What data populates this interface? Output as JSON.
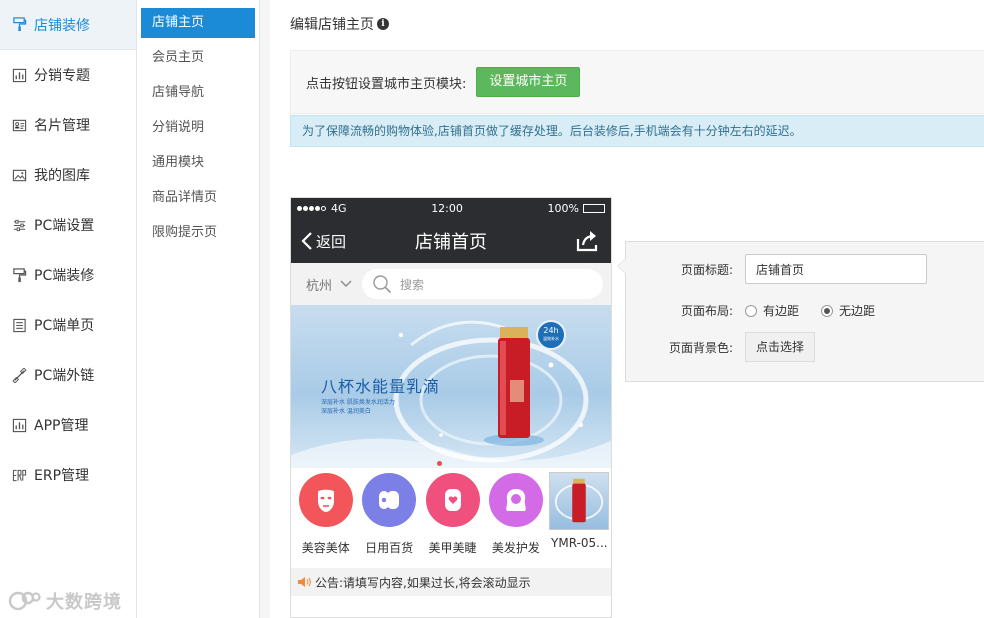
{
  "left_nav": {
    "items": [
      {
        "label": "店铺装修",
        "icon": "brush-icon",
        "active": true
      },
      {
        "label": "分销专题",
        "icon": "chart-icon"
      },
      {
        "label": "名片管理",
        "icon": "card-icon"
      },
      {
        "label": "我的图库",
        "icon": "image-icon"
      },
      {
        "label": "PC端设置",
        "icon": "sliders-icon"
      },
      {
        "label": "PC端装修",
        "icon": "brush-icon"
      },
      {
        "label": "PC端单页",
        "icon": "page-icon"
      },
      {
        "label": "PC端外链",
        "icon": "link-icon"
      },
      {
        "label": "APP管理",
        "icon": "chart-icon"
      },
      {
        "label": "ERP管理",
        "icon": "erp-icon"
      }
    ]
  },
  "watermark": "大数跨境",
  "sub_nav": {
    "items": [
      {
        "label": "店铺主页",
        "active": true
      },
      {
        "label": "会员主页"
      },
      {
        "label": "店铺导航"
      },
      {
        "label": "分销说明"
      },
      {
        "label": "通用模块"
      },
      {
        "label": "商品详情页"
      },
      {
        "label": "限购提示页"
      }
    ]
  },
  "main": {
    "title": "编辑店铺主页",
    "city_box": {
      "label": "点击按钮设置城市主页模块:",
      "button": "设置城市主页"
    },
    "notice": "为了保障流畅的购物体验,店铺首页做了缓存处理。后台装修后,手机端会有十分钟左右的延迟。"
  },
  "phone": {
    "status": {
      "network": "4G",
      "time": "12:00",
      "battery": "100%"
    },
    "back": "返回",
    "title": "店铺首页",
    "city": "杭州",
    "search_placeholder": "搜索",
    "banner": {
      "headline": "八杯水能量乳滴",
      "sub1": "深层补水  肌肤焕发水润活力",
      "sub2": "深层补水  温润美白",
      "badge_top": "24h",
      "badge_bottom": "温效补水"
    },
    "categories": [
      {
        "label": "美容美体",
        "color": "#f2565a",
        "icon": "face-mask-icon"
      },
      {
        "label": "日用百货",
        "color": "#7b7fe6",
        "icon": "tissue-roll-icon"
      },
      {
        "label": "美甲美睫",
        "color": "#f0507e",
        "icon": "nail-icon"
      },
      {
        "label": "美发护发",
        "color": "#d36be6",
        "icon": "hair-icon"
      },
      {
        "label": "YMR-05...",
        "image": true
      }
    ],
    "announcement": "公告:请填写内容,如果过长,将会滚动显示"
  },
  "settings": {
    "title_label": "页面标题:",
    "title_value": "店铺首页",
    "layout_label": "页面布局:",
    "layout_options": [
      "有边距",
      "无边距"
    ],
    "layout_selected": "无边距",
    "bg_label": "页面背景色:",
    "bg_button": "点击选择"
  }
}
